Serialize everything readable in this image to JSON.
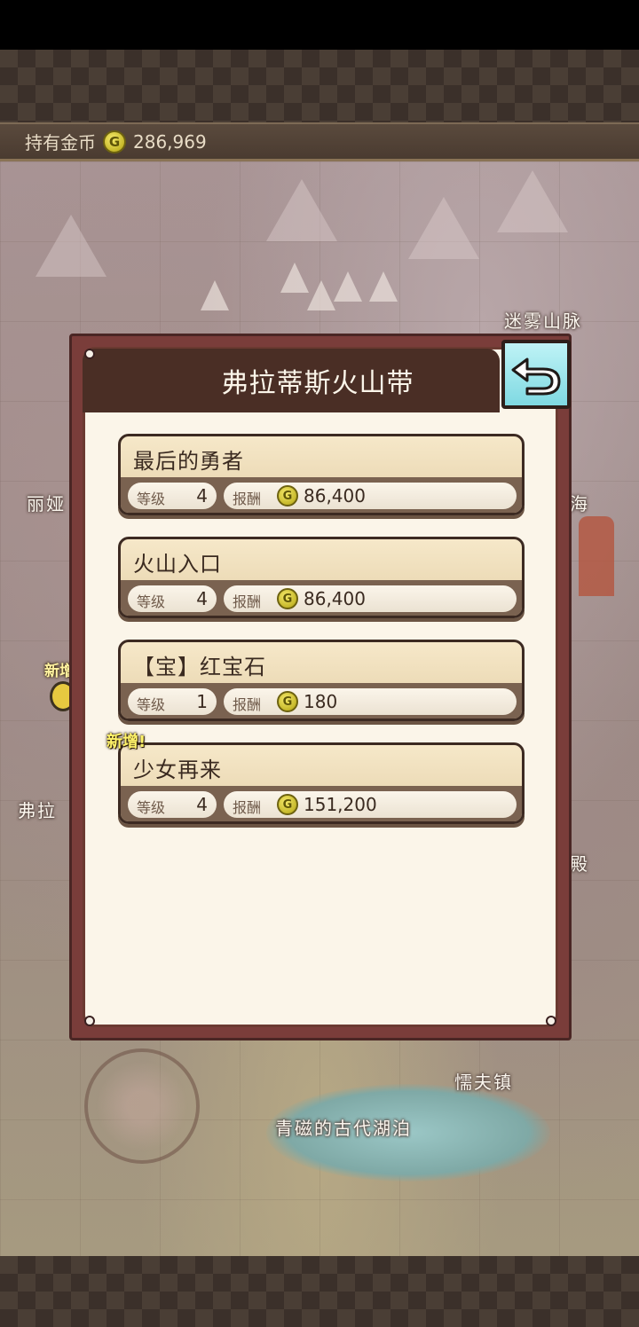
{
  "header": {
    "gold_label": "持有金币",
    "coin_symbol": "G",
    "gold_value": "286,969"
  },
  "map": {
    "labels": {
      "misty_mountains": "迷雾山脉",
      "lia": "丽娅",
      "sea": "海",
      "flatis_left": "弗拉",
      "temple": "殿",
      "town": "懦夫镇",
      "lake": "青磁的古代湖泊",
      "new_left": "新增"
    }
  },
  "dialog": {
    "title": "弗拉蒂斯火山带",
    "quests": [
      {
        "name": "最后的勇者",
        "level_label": "等级",
        "level": "4",
        "reward_label": "报酬",
        "coin_symbol": "G",
        "reward": "86,400",
        "badge": ""
      },
      {
        "name": "火山入口",
        "level_label": "等级",
        "level": "4",
        "reward_label": "报酬",
        "coin_symbol": "G",
        "reward": "86,400",
        "badge": ""
      },
      {
        "name": "【宝】红宝石",
        "level_label": "等级",
        "level": "1",
        "reward_label": "报酬",
        "coin_symbol": "G",
        "reward": "180",
        "badge": ""
      },
      {
        "name": "少女再来",
        "level_label": "等级",
        "level": "4",
        "reward_label": "报酬",
        "coin_symbol": "G",
        "reward": "151,200",
        "badge": "新增!"
      }
    ]
  },
  "colors": {
    "dialog_frame": "#7a3d3a",
    "dialog_header": "#4a2e25",
    "back_button": "#7fd9e2",
    "coin": "#c6b82a"
  },
  "icons": {
    "back": "back-arrow-icon",
    "coin": "gold-coin-icon"
  }
}
